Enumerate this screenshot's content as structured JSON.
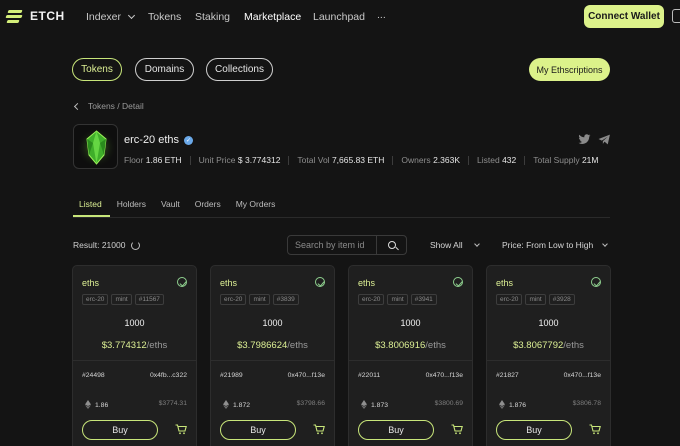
{
  "nav": {
    "logo": "ETCH",
    "links": [
      "Indexer",
      "Tokens",
      "Staking",
      "Marketplace",
      "Launchpad",
      "..."
    ],
    "active": "Marketplace",
    "connect_label": "Connect Wallet"
  },
  "pills": [
    "Tokens",
    "Domains",
    "Collections"
  ],
  "my_ethscriptions_label": "My Ethscriptions",
  "breadcrumb": {
    "path": "Tokens / Detail"
  },
  "token": {
    "name": "erc-20 eths",
    "stats": [
      {
        "label": "Floor",
        "value": "1.86 ETH"
      },
      {
        "label": "Unit Price",
        "value": "$ 3.774312"
      },
      {
        "label": "Total Vol",
        "value": "7,665.83 ETH"
      },
      {
        "label": "Owners",
        "value": "2.363K"
      },
      {
        "label": "Listed",
        "value": "432"
      },
      {
        "label": "Total Supply",
        "value": "21M"
      }
    ]
  },
  "subtabs": [
    "Listed",
    "Holders",
    "Vault",
    "Orders",
    "My Orders"
  ],
  "toolbar": {
    "result": "Result: 21000",
    "search_placeholder": "Search by item id",
    "show_filter": "Show All",
    "sort": "Price: From Low to High"
  },
  "cards": [
    {
      "title": "eths",
      "tags": [
        "erc-20",
        "mint",
        "#11567"
      ],
      "amount": "1000",
      "price": "$3.774312",
      "unit": "/eths",
      "inscription": "#24498",
      "address": "0x4fb...c322",
      "eth": "1.86",
      "usd": "$3774.31",
      "buy": "Buy"
    },
    {
      "title": "eths",
      "tags": [
        "erc-20",
        "mint",
        "#3839"
      ],
      "amount": "1000",
      "price": "$3.7986624",
      "unit": "/eths",
      "inscription": "#21989",
      "address": "0x470...f13e",
      "eth": "1.872",
      "usd": "$3798.66",
      "buy": "Buy"
    },
    {
      "title": "eths",
      "tags": [
        "erc-20",
        "mint",
        "#3941"
      ],
      "amount": "1000",
      "price": "$3.8006916",
      "unit": "/eths",
      "inscription": "#22011",
      "address": "0x470...f13e",
      "eth": "1.873",
      "usd": "$3800.69",
      "buy": "Buy"
    },
    {
      "title": "eths",
      "tags": [
        "erc-20",
        "mint",
        "#3928"
      ],
      "amount": "1000",
      "price": "$3.8067792",
      "unit": "/eths",
      "inscription": "#21827",
      "address": "0x470...f13e",
      "eth": "1.876",
      "usd": "$3806.78",
      "buy": "Buy"
    }
  ],
  "colors": {
    "accent": "#dcf28a",
    "background": "#141414",
    "card": "#1f1f1f"
  }
}
